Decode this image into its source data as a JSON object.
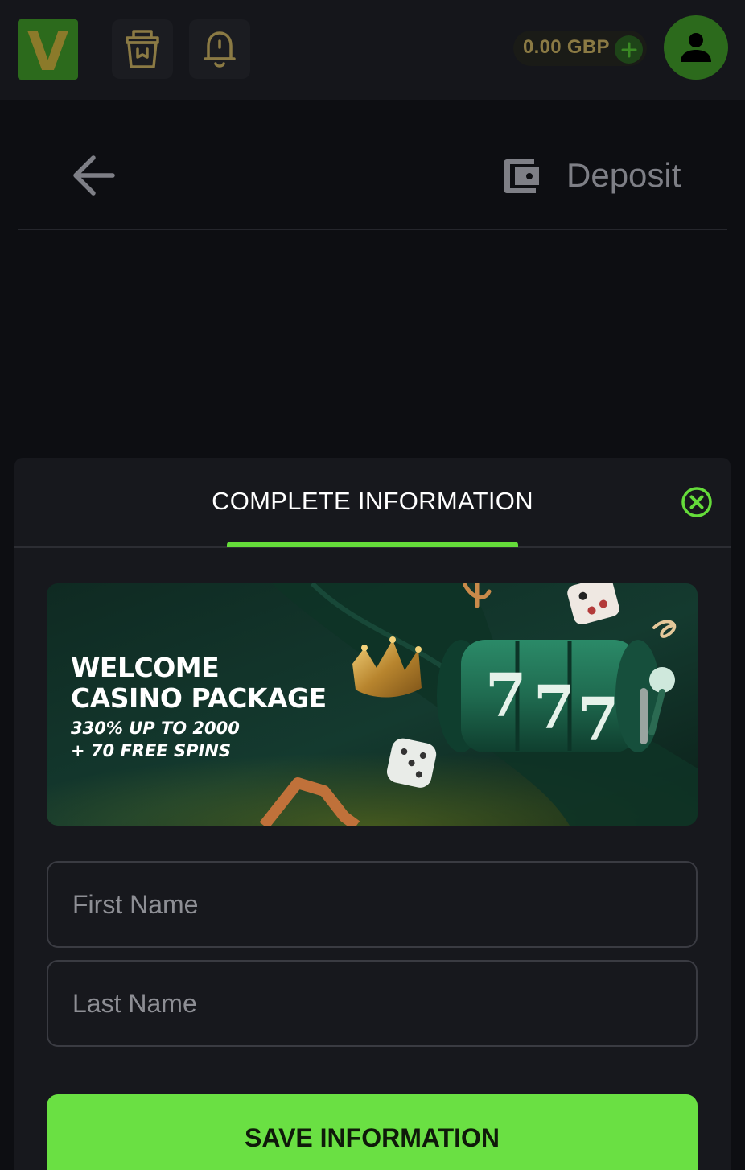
{
  "topbar": {
    "logo_letter": "V",
    "balance": "0.00 GBP",
    "icons": [
      "gift-bucket-icon",
      "bell-icon",
      "plus-icon",
      "user-icon"
    ]
  },
  "header": {
    "title": "Deposit",
    "icons": [
      "back-arrow-icon",
      "wallet-icon"
    ]
  },
  "modal": {
    "title": "COMPLETE INFORMATION",
    "close_icon": "close-circle-icon",
    "banner": {
      "line1": "WELCOME",
      "line2": "CASINO PACKAGE",
      "line3": "330% UP TO 2000",
      "line4": "+ 70 FREE SPINS",
      "slot_digits": [
        "7",
        "7",
        "7"
      ]
    },
    "first_name": {
      "value": "",
      "placeholder": "First Name"
    },
    "last_name": {
      "value": "",
      "placeholder": "Last Name"
    },
    "save_label": "SAVE INFORMATION"
  },
  "colors": {
    "accent_green": "#65dc3a",
    "brand_dark_green": "#2c6a1c",
    "logo_gold": "#8b7a2a",
    "background": "#0d0e12",
    "panel": "#17181d"
  }
}
